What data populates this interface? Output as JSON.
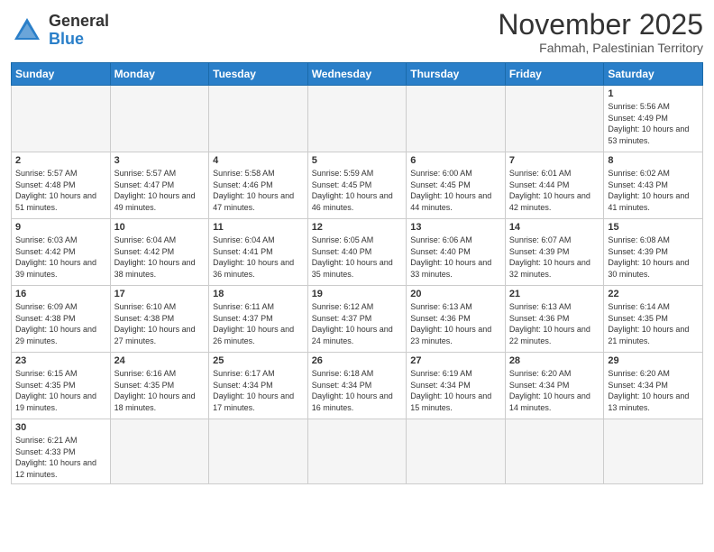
{
  "logo": {
    "general": "General",
    "blue": "Blue"
  },
  "title": {
    "month": "November 2025",
    "location": "Fahmah, Palestinian Territory"
  },
  "weekdays": [
    "Sunday",
    "Monday",
    "Tuesday",
    "Wednesday",
    "Thursday",
    "Friday",
    "Saturday"
  ],
  "weeks": [
    [
      {
        "day": "",
        "info": ""
      },
      {
        "day": "",
        "info": ""
      },
      {
        "day": "",
        "info": ""
      },
      {
        "day": "",
        "info": ""
      },
      {
        "day": "",
        "info": ""
      },
      {
        "day": "",
        "info": ""
      },
      {
        "day": "1",
        "info": "Sunrise: 5:56 AM\nSunset: 4:49 PM\nDaylight: 10 hours and 53 minutes."
      }
    ],
    [
      {
        "day": "2",
        "info": "Sunrise: 5:57 AM\nSunset: 4:48 PM\nDaylight: 10 hours and 51 minutes."
      },
      {
        "day": "3",
        "info": "Sunrise: 5:57 AM\nSunset: 4:47 PM\nDaylight: 10 hours and 49 minutes."
      },
      {
        "day": "4",
        "info": "Sunrise: 5:58 AM\nSunset: 4:46 PM\nDaylight: 10 hours and 47 minutes."
      },
      {
        "day": "5",
        "info": "Sunrise: 5:59 AM\nSunset: 4:45 PM\nDaylight: 10 hours and 46 minutes."
      },
      {
        "day": "6",
        "info": "Sunrise: 6:00 AM\nSunset: 4:45 PM\nDaylight: 10 hours and 44 minutes."
      },
      {
        "day": "7",
        "info": "Sunrise: 6:01 AM\nSunset: 4:44 PM\nDaylight: 10 hours and 42 minutes."
      },
      {
        "day": "8",
        "info": "Sunrise: 6:02 AM\nSunset: 4:43 PM\nDaylight: 10 hours and 41 minutes."
      }
    ],
    [
      {
        "day": "9",
        "info": "Sunrise: 6:03 AM\nSunset: 4:42 PM\nDaylight: 10 hours and 39 minutes."
      },
      {
        "day": "10",
        "info": "Sunrise: 6:04 AM\nSunset: 4:42 PM\nDaylight: 10 hours and 38 minutes."
      },
      {
        "day": "11",
        "info": "Sunrise: 6:04 AM\nSunset: 4:41 PM\nDaylight: 10 hours and 36 minutes."
      },
      {
        "day": "12",
        "info": "Sunrise: 6:05 AM\nSunset: 4:40 PM\nDaylight: 10 hours and 35 minutes."
      },
      {
        "day": "13",
        "info": "Sunrise: 6:06 AM\nSunset: 4:40 PM\nDaylight: 10 hours and 33 minutes."
      },
      {
        "day": "14",
        "info": "Sunrise: 6:07 AM\nSunset: 4:39 PM\nDaylight: 10 hours and 32 minutes."
      },
      {
        "day": "15",
        "info": "Sunrise: 6:08 AM\nSunset: 4:39 PM\nDaylight: 10 hours and 30 minutes."
      }
    ],
    [
      {
        "day": "16",
        "info": "Sunrise: 6:09 AM\nSunset: 4:38 PM\nDaylight: 10 hours and 29 minutes."
      },
      {
        "day": "17",
        "info": "Sunrise: 6:10 AM\nSunset: 4:38 PM\nDaylight: 10 hours and 27 minutes."
      },
      {
        "day": "18",
        "info": "Sunrise: 6:11 AM\nSunset: 4:37 PM\nDaylight: 10 hours and 26 minutes."
      },
      {
        "day": "19",
        "info": "Sunrise: 6:12 AM\nSunset: 4:37 PM\nDaylight: 10 hours and 24 minutes."
      },
      {
        "day": "20",
        "info": "Sunrise: 6:13 AM\nSunset: 4:36 PM\nDaylight: 10 hours and 23 minutes."
      },
      {
        "day": "21",
        "info": "Sunrise: 6:13 AM\nSunset: 4:36 PM\nDaylight: 10 hours and 22 minutes."
      },
      {
        "day": "22",
        "info": "Sunrise: 6:14 AM\nSunset: 4:35 PM\nDaylight: 10 hours and 21 minutes."
      }
    ],
    [
      {
        "day": "23",
        "info": "Sunrise: 6:15 AM\nSunset: 4:35 PM\nDaylight: 10 hours and 19 minutes."
      },
      {
        "day": "24",
        "info": "Sunrise: 6:16 AM\nSunset: 4:35 PM\nDaylight: 10 hours and 18 minutes."
      },
      {
        "day": "25",
        "info": "Sunrise: 6:17 AM\nSunset: 4:34 PM\nDaylight: 10 hours and 17 minutes."
      },
      {
        "day": "26",
        "info": "Sunrise: 6:18 AM\nSunset: 4:34 PM\nDaylight: 10 hours and 16 minutes."
      },
      {
        "day": "27",
        "info": "Sunrise: 6:19 AM\nSunset: 4:34 PM\nDaylight: 10 hours and 15 minutes."
      },
      {
        "day": "28",
        "info": "Sunrise: 6:20 AM\nSunset: 4:34 PM\nDaylight: 10 hours and 14 minutes."
      },
      {
        "day": "29",
        "info": "Sunrise: 6:20 AM\nSunset: 4:34 PM\nDaylight: 10 hours and 13 minutes."
      }
    ],
    [
      {
        "day": "30",
        "info": "Sunrise: 6:21 AM\nSunset: 4:33 PM\nDaylight: 10 hours and 12 minutes."
      },
      {
        "day": "",
        "info": ""
      },
      {
        "day": "",
        "info": ""
      },
      {
        "day": "",
        "info": ""
      },
      {
        "day": "",
        "info": ""
      },
      {
        "day": "",
        "info": ""
      },
      {
        "day": "",
        "info": ""
      }
    ]
  ]
}
